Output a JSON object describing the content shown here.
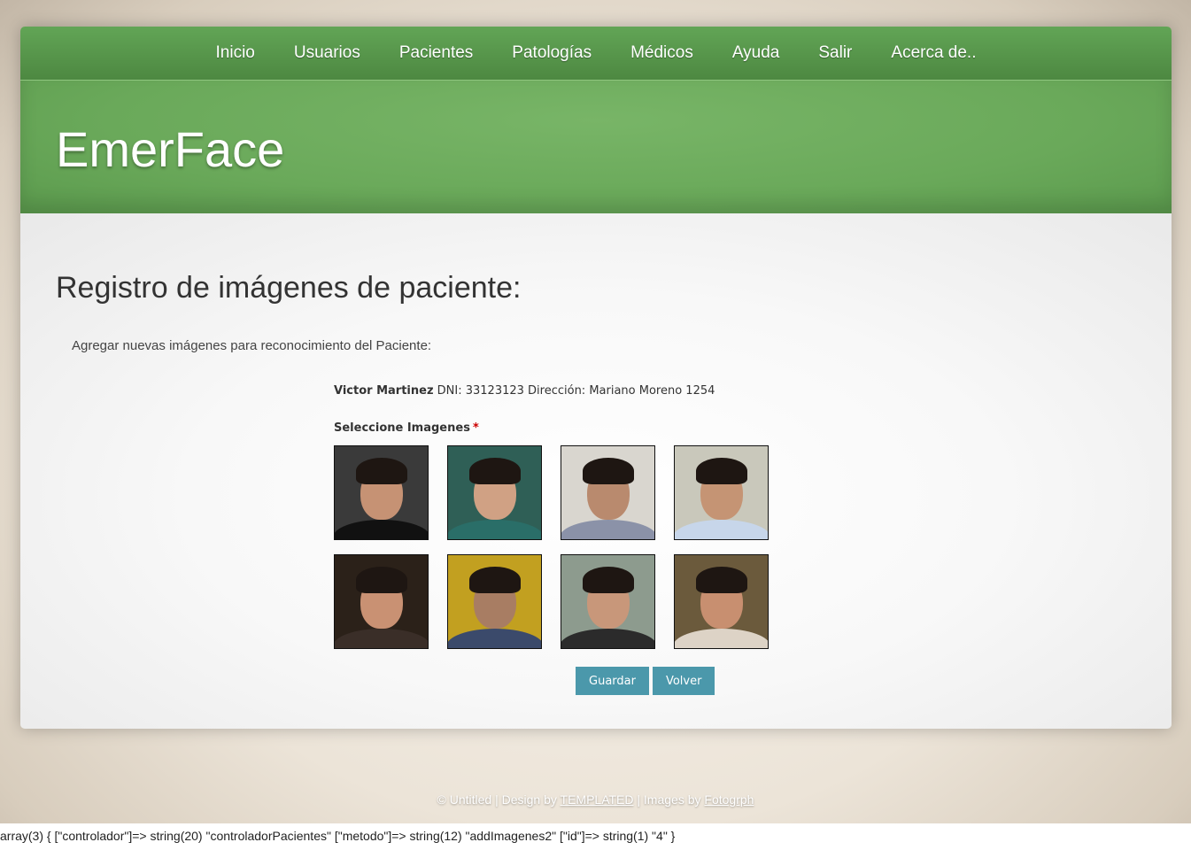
{
  "nav": {
    "items": [
      "Inicio",
      "Usuarios",
      "Pacientes",
      "Patologías",
      "Médicos",
      "Ayuda",
      "Salir",
      "Acerca de.."
    ]
  },
  "banner": {
    "logo": "EmerFace"
  },
  "main": {
    "title": "Registro de imágenes de paciente:",
    "intro": "Agregar nuevas imágenes para reconocimiento del Paciente:",
    "patient": {
      "name": "Victor Martinez",
      "details": " DNI: 33123123 Dirección: Mariano Moreno 1254"
    },
    "select_label": "Seleccione Imagenes",
    "required_mark": "*",
    "images": [
      {
        "bg": "#3a3a3a",
        "shirt": "#111111",
        "skin": "#c69274"
      },
      {
        "bg": "#2f5f56",
        "shirt": "#2a6e68",
        "skin": "#d0a184"
      },
      {
        "bg": "#d9d6cf",
        "shirt": "#8b92a8",
        "skin": "#b98a6e"
      },
      {
        "bg": "#c9c8bb",
        "shirt": "#c7d6ea",
        "skin": "#c59474"
      },
      {
        "bg": "#2b2119",
        "shirt": "#3a2e28",
        "skin": "#c99173"
      },
      {
        "bg": "#c2a020",
        "shirt": "#3b4a6b",
        "skin": "#a87d63"
      },
      {
        "bg": "#8d9b8e",
        "shirt": "#2b2b2b",
        "skin": "#c8977a"
      },
      {
        "bg": "#6b5a3c",
        "shirt": "#ddd3c6",
        "skin": "#c88f70"
      }
    ],
    "buttons": {
      "save": "Guardar",
      "back": "Volver"
    }
  },
  "footer": {
    "copyright": "© Untitled | Design by ",
    "design_link": "TEMPLATED",
    "separator": " | Images by ",
    "images_link": "Fotogrph"
  },
  "debug": "array(3) { [\"controlador\"]=> string(20) \"controladorPacientes\" [\"metodo\"]=> string(12) \"addImagenes2\" [\"id\"]=> string(1) \"4\" }"
}
